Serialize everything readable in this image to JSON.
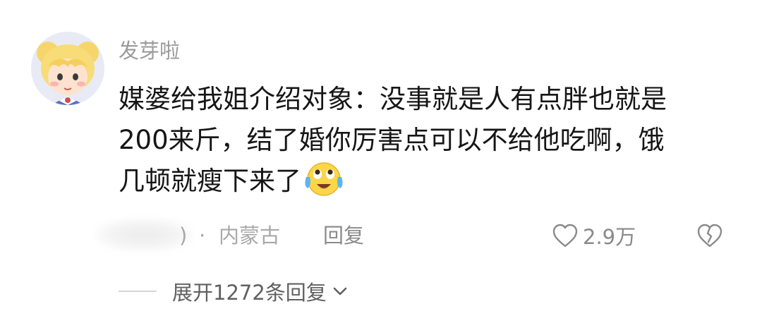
{
  "comment": {
    "username": "发芽啦",
    "content_lines": [
      "媒婆给我姐介绍对象：没事就是人有点胖也就是",
      "200来斤，结了婚你厉害点可以不给他吃啊，饿",
      "几顿就瘦下来了"
    ],
    "emoji_icon": "crying-laughing-face-icon",
    "time_tail": ")",
    "separator": "·",
    "location": "内蒙古",
    "reply_label": "回复",
    "like_icon": "heart-outline-icon",
    "like_count": "2.9万",
    "dislike_icon": "broken-heart-icon",
    "expand_label": "展开1272条回复",
    "expand_icon": "chevron-down-icon"
  }
}
